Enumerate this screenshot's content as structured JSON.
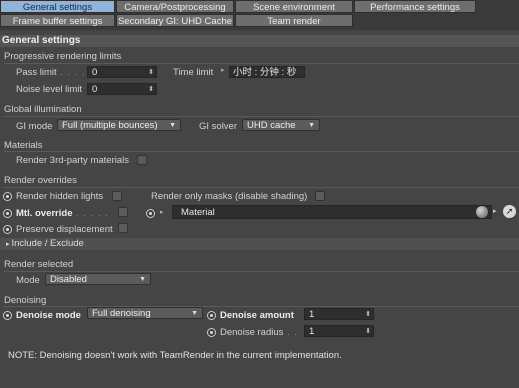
{
  "tabs": {
    "row1": [
      "General settings",
      "Camera/Postprocessing",
      "Scene environment",
      "Performance settings"
    ],
    "row2": [
      "Frame buffer settings",
      "Secondary GI: UHD Cache",
      "Team render"
    ]
  },
  "header": {
    "title": "General settings"
  },
  "progressive": {
    "group": "Progressive rendering limits",
    "pass_limit_label": "Pass limit",
    "pass_limit_value": "0",
    "noise_limit_label": "Noise level limit",
    "noise_limit_value": "0",
    "time_limit_label": "Time limit",
    "time_limit_value": "小时 : 分钟 : 秒"
  },
  "gi": {
    "group": "Global illumination",
    "mode_label": "GI mode",
    "mode_value": "Full (multiple bounces)",
    "solver_label": "GI solver",
    "solver_value": "UHD cache"
  },
  "materials": {
    "group": "Materials",
    "render_3rd_label": "Render 3rd-party materials"
  },
  "overrides": {
    "group": "Render overrides",
    "hidden_lights_label": "Render hidden lights",
    "only_masks_label": "Render only masks (disable shading)",
    "mtl_override_label": "Mtl. override",
    "material_value": "Material",
    "preserve_disp_label": "Preserve displacement"
  },
  "include_exclude": {
    "label": "Include / Exclude"
  },
  "render_selected": {
    "group": "Render selected",
    "mode_label": "Mode",
    "mode_value": "Disabled"
  },
  "denoising": {
    "group": "Denoising",
    "mode_label": "Denoise mode",
    "mode_value": "Full denoising",
    "amount_label": "Denoise amount",
    "amount_value": "1",
    "radius_label": "Denoise radius",
    "radius_value": "1"
  },
  "note": "NOTE: Denoising doesn't work with TeamRender in the current implementation."
}
